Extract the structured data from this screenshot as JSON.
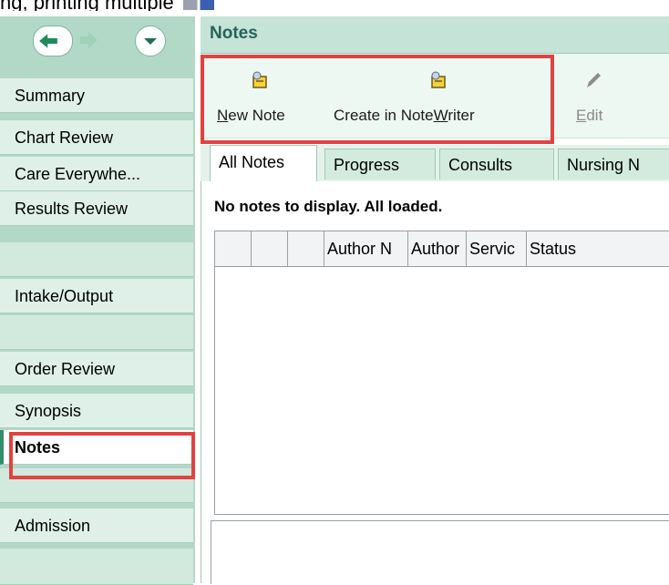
{
  "window": {
    "caption_partial": "ng, printing multiple"
  },
  "nav": {
    "items": [
      {
        "label": "Summary"
      },
      {
        "label": "Chart Review"
      },
      {
        "label": "Care Everywhe..."
      },
      {
        "label": "Results Review"
      },
      {
        "label": ""
      },
      {
        "label": "Intake/Output"
      },
      {
        "label": ""
      },
      {
        "label": "Order Review"
      },
      {
        "label": "Synopsis"
      },
      {
        "label": "Notes",
        "selected": true
      },
      {
        "label": ""
      },
      {
        "label": "Admission"
      }
    ]
  },
  "main": {
    "title": "Notes",
    "toolbar": {
      "new_note": {
        "accel": "N",
        "rest": "ew Note",
        "icon": "new-note-icon"
      },
      "create_notewriter": {
        "pre": "Create in Note",
        "accel": "W",
        "post": "riter",
        "icon": "notewriter-icon"
      },
      "edit": {
        "accel": "E",
        "rest": "dit",
        "icon": "pencil-icon",
        "disabled": true
      }
    },
    "tabs": [
      {
        "label": "All Notes",
        "active": true
      },
      {
        "label": "Progress"
      },
      {
        "label": "Consults"
      },
      {
        "label": "Nursing N"
      }
    ],
    "status_text": "No notes to display. All loaded.",
    "columns": [
      {
        "label": ""
      },
      {
        "label": ""
      },
      {
        "label": ""
      },
      {
        "label": "Author N"
      },
      {
        "label": "Author"
      },
      {
        "label": "Servic"
      },
      {
        "label": "Status"
      }
    ]
  },
  "colors": {
    "sidebar": "#b2d8c8",
    "nav_item": "#dff0e8",
    "header": "#c6e3d7",
    "title_text": "#23635a",
    "highlight_box": "#e2423f",
    "nav_arrow_back": "#1f8a5a",
    "nav_arrow_forward": "#9fd2b9"
  }
}
